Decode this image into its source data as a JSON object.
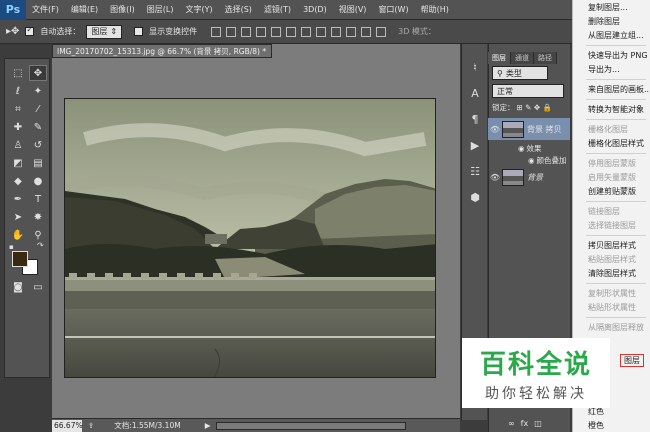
{
  "menubar": {
    "logo": "Ps",
    "items": [
      "文件(F)",
      "编辑(E)",
      "图像(I)",
      "图层(L)",
      "文字(Y)",
      "选择(S)",
      "滤镜(T)",
      "3D(D)",
      "视图(V)",
      "窗口(W)",
      "帮助(H)"
    ]
  },
  "options": {
    "auto_select_label": "自动选择：",
    "auto_select_value": "图层",
    "show_transform_label": "显示变换控件",
    "mode_3d_label": "3D 模式："
  },
  "document": {
    "tab_title": "IMG_20170702_15313.jpg @ 66.7% (背景 拷贝, RGB/8) *",
    "zoom": "66.67%",
    "doc_info": "文档:1.55M/3.10M"
  },
  "layers_panel": {
    "tabs": [
      "图层",
      "通道",
      "路径"
    ],
    "kind_label": "类型",
    "blend_mode": "正常",
    "lock_label": "锁定：",
    "layers": [
      {
        "name": "背景 拷贝",
        "effects_label": "效果",
        "effect_name": "颜色叠加"
      },
      {
        "name": "背景"
      }
    ]
  },
  "context_menu": {
    "items": [
      {
        "label": "复制图层...",
        "disabled": false
      },
      {
        "label": "删除图层",
        "disabled": false
      },
      {
        "label": "从图层建立组...",
        "disabled": false
      },
      {
        "label": "快速导出为 PNG",
        "disabled": false
      },
      {
        "label": "导出为...",
        "disabled": false
      },
      {
        "label": "来自图层的画板...",
        "disabled": false
      },
      {
        "label": "转换为智能对象",
        "disabled": false
      },
      {
        "label": "栅格化图层",
        "disabled": true
      },
      {
        "label": "栅格化图层样式",
        "disabled": false
      },
      {
        "label": "停用图层蒙版",
        "disabled": true
      },
      {
        "label": "启用矢量蒙版",
        "disabled": true
      },
      {
        "label": "创建剪贴蒙版",
        "disabled": false
      },
      {
        "label": "链接图层",
        "disabled": true
      },
      {
        "label": "选择链接图层",
        "disabled": true
      },
      {
        "label": "拷贝图层样式",
        "disabled": false
      },
      {
        "label": "粘贴图层样式",
        "disabled": true
      },
      {
        "label": "清除图层样式",
        "disabled": false
      },
      {
        "label": "复制形状属性",
        "disabled": true
      },
      {
        "label": "粘贴形状属性",
        "disabled": true
      },
      {
        "label": "从隔离图层释放",
        "disabled": true
      },
      {
        "label": "图层",
        "disabled": false
      },
      {
        "label": "红色",
        "disabled": false
      },
      {
        "label": "橙色",
        "disabled": false
      }
    ]
  },
  "watermark": {
    "title": "百科全说",
    "subtitle": "助你轻松解决"
  },
  "colors": {
    "foreground": "#3a2a10",
    "background": "#ffffff"
  }
}
